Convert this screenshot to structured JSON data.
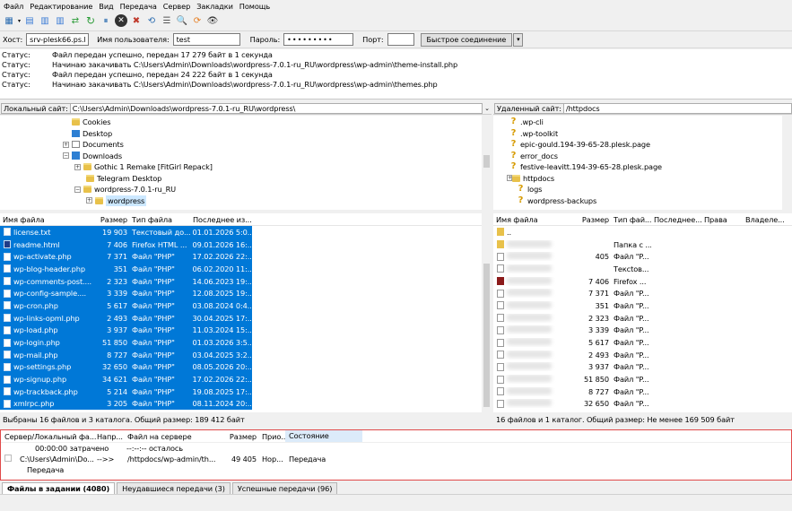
{
  "menu": [
    "Файл",
    "Редактирование",
    "Вид",
    "Передача",
    "Сервер",
    "Закладки",
    "Помощь"
  ],
  "quickconnect": {
    "host_label": "Хост:",
    "host": "srv-plesk66.ps.kz",
    "user_label": "Имя пользователя:",
    "user": "test",
    "pass_label": "Пароль:",
    "pass": "•••••••••",
    "port_label": "Порт:",
    "port": "",
    "button": "Быстрое соединение"
  },
  "log": [
    {
      "s": "Статус:",
      "m": "Файл передан успешно, передан 17 279 байт в 1 секунда"
    },
    {
      "s": "Статус:",
      "m": "Начинаю закачивать C:\\Users\\Admin\\Downloads\\wordpress-7.0.1-ru_RU\\wordpress\\wp-admin\\theme-install.php"
    },
    {
      "s": "Статус:",
      "m": "Файл передан успешно, передан 24 222 байт в 1 секунда"
    },
    {
      "s": "Статус:",
      "m": "Начинаю закачивать C:\\Users\\Admin\\Downloads\\wordpress-7.0.1-ru_RU\\wordpress\\wp-admin\\themes.php"
    }
  ],
  "local": {
    "label": "Локальный сайт:",
    "path": "C:\\Users\\Admin\\Downloads\\wordpress-7.0.1-ru_RU\\wordpress\\",
    "tree": [
      "Cookies",
      "Desktop",
      "Documents",
      "Downloads",
      "Gothic 1 Remake [FitGirl Repack]",
      "Telegram Desktop",
      "wordpress-7.0.1-ru_RU",
      "wordpress"
    ],
    "headers": [
      "Имя файла",
      "Размер",
      "Тип файла",
      "Последнее из..."
    ],
    "files": [
      [
        "license.txt",
        "19 903",
        "Текстовый до...",
        "01.01.2026 5:0..."
      ],
      [
        "readme.html",
        "7 406",
        "Firefox HTML ...",
        "09.01.2026 16:..."
      ],
      [
        "wp-activate.php",
        "7 371",
        "Файл \"PHP\"",
        "17.02.2026 22:..."
      ],
      [
        "wp-blog-header.php",
        "351",
        "Файл \"PHP\"",
        "06.02.2020 11:..."
      ],
      [
        "wp-comments-post....",
        "2 323",
        "Файл \"PHP\"",
        "14.06.2023 19:..."
      ],
      [
        "wp-config-sample....",
        "3 339",
        "Файл \"PHP\"",
        "12.08.2025 19:..."
      ],
      [
        "wp-cron.php",
        "5 617",
        "Файл \"PHP\"",
        "03.08.2024 0:4..."
      ],
      [
        "wp-links-opml.php",
        "2 493",
        "Файл \"PHP\"",
        "30.04.2025 17:..."
      ],
      [
        "wp-load.php",
        "3 937",
        "Файл \"PHP\"",
        "11.03.2024 15:..."
      ],
      [
        "wp-login.php",
        "51 850",
        "Файл \"PHP\"",
        "01.03.2026 3:5..."
      ],
      [
        "wp-mail.php",
        "8 727",
        "Файл \"PHP\"",
        "03.04.2025 3:2..."
      ],
      [
        "wp-settings.php",
        "32 650",
        "Файл \"PHP\"",
        "08.05.2026 20:..."
      ],
      [
        "wp-signup.php",
        "34 621",
        "Файл \"PHP\"",
        "17.02.2026 22:..."
      ],
      [
        "wp-trackback.php",
        "5 214",
        "Файл \"PHP\"",
        "19.08.2025 17:..."
      ],
      [
        "xmlrpc.php",
        "3 205",
        "Файл \"PHP\"",
        "08.11.2024 20:..."
      ]
    ],
    "status": "Выбраны 16 файлов и 3 каталога. Общий размер: 189 412 байт"
  },
  "remote": {
    "label": "Удаленный сайт:",
    "path": "/httpdocs",
    "tree": [
      ".wp-cli",
      ".wp-toolkit",
      "epic-gould.194-39-65-28.plesk.page",
      "error_docs",
      "festive-leavitt.194-39-65-28.plesk.page",
      "httpdocs",
      "logs",
      "wordpress-backups"
    ],
    "headers": [
      "Имя файла",
      "Размер",
      "Тип фай...",
      "Последнее...",
      "Права",
      "Владеле..."
    ],
    "files": [
      [
        "..",
        "",
        ""
      ],
      [
        "",
        "",
        "Папка с ..."
      ],
      [
        "",
        "405",
        "Файл \"P..."
      ],
      [
        "",
        "",
        "Тексtов..."
      ],
      [
        "",
        "7 406",
        "Firefox ..."
      ],
      [
        "",
        "7 371",
        "Файл \"P..."
      ],
      [
        "",
        "351",
        "Файл \"P..."
      ],
      [
        "",
        "2 323",
        "Файл \"P..."
      ],
      [
        "",
        "3 339",
        "Файл \"P..."
      ],
      [
        "",
        "5 617",
        "Файл \"P..."
      ],
      [
        "",
        "2 493",
        "Файл \"P..."
      ],
      [
        "",
        "3 937",
        "Файл \"P..."
      ],
      [
        "",
        "51 850",
        "Файл \"P..."
      ],
      [
        "",
        "8 727",
        "Файл \"P..."
      ],
      [
        "",
        "32 650",
        "Файл \"P..."
      ]
    ],
    "status": "16 файлов и 1 каталог. Общий размер: Не менее 169 509 байт"
  },
  "queue": {
    "headers": [
      "Сервер/Локальный фа...",
      "Напр...",
      "Файл на сервере",
      "Размер",
      "Прио...",
      "Состояние"
    ],
    "elapsed": "00:00:00 затрачено",
    "left": "--:--:-- осталось",
    "local_file": "C:\\Users\\Admin\\Do...",
    "dir": "-->>",
    "remote_file": "/httpdocs/wp-admin/th...",
    "size": "49 405",
    "prio": "Нор...",
    "state": "Передача",
    "sub": "Передача"
  },
  "tabs": [
    "Файлы в задании (4080)",
    "Неудавшиеся передачи (3)",
    "Успешные передачи (96)"
  ]
}
